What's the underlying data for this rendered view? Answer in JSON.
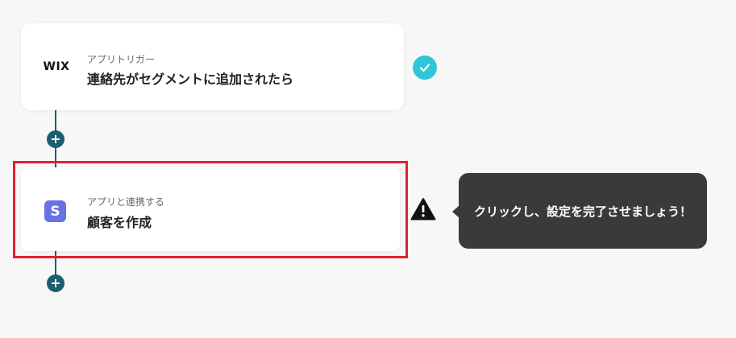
{
  "colors": {
    "background": "#f7f7f7",
    "card": "#ffffff",
    "highlight_border": "#e3212b",
    "connector": "#1b5e6f",
    "success": "#2cc7d9",
    "tooltip_bg": "#3a3a3a",
    "stripe_brand": "#6772e5"
  },
  "flow": {
    "trigger": {
      "app_logo": "WIX",
      "subtitle": "アプリトリガー",
      "title": "連絡先がセグメントに追加されたら",
      "status_icon": "check-icon",
      "status": "completed"
    },
    "action": {
      "app_logo": "S",
      "subtitle": "アプリと連携する",
      "title": "顧客を作成",
      "status_icon": "warning-icon",
      "status": "incomplete",
      "highlighted": true
    },
    "add_step_icon": "plus-icon"
  },
  "tooltip": {
    "text": "クリックし、設定を完了させましょう！"
  }
}
